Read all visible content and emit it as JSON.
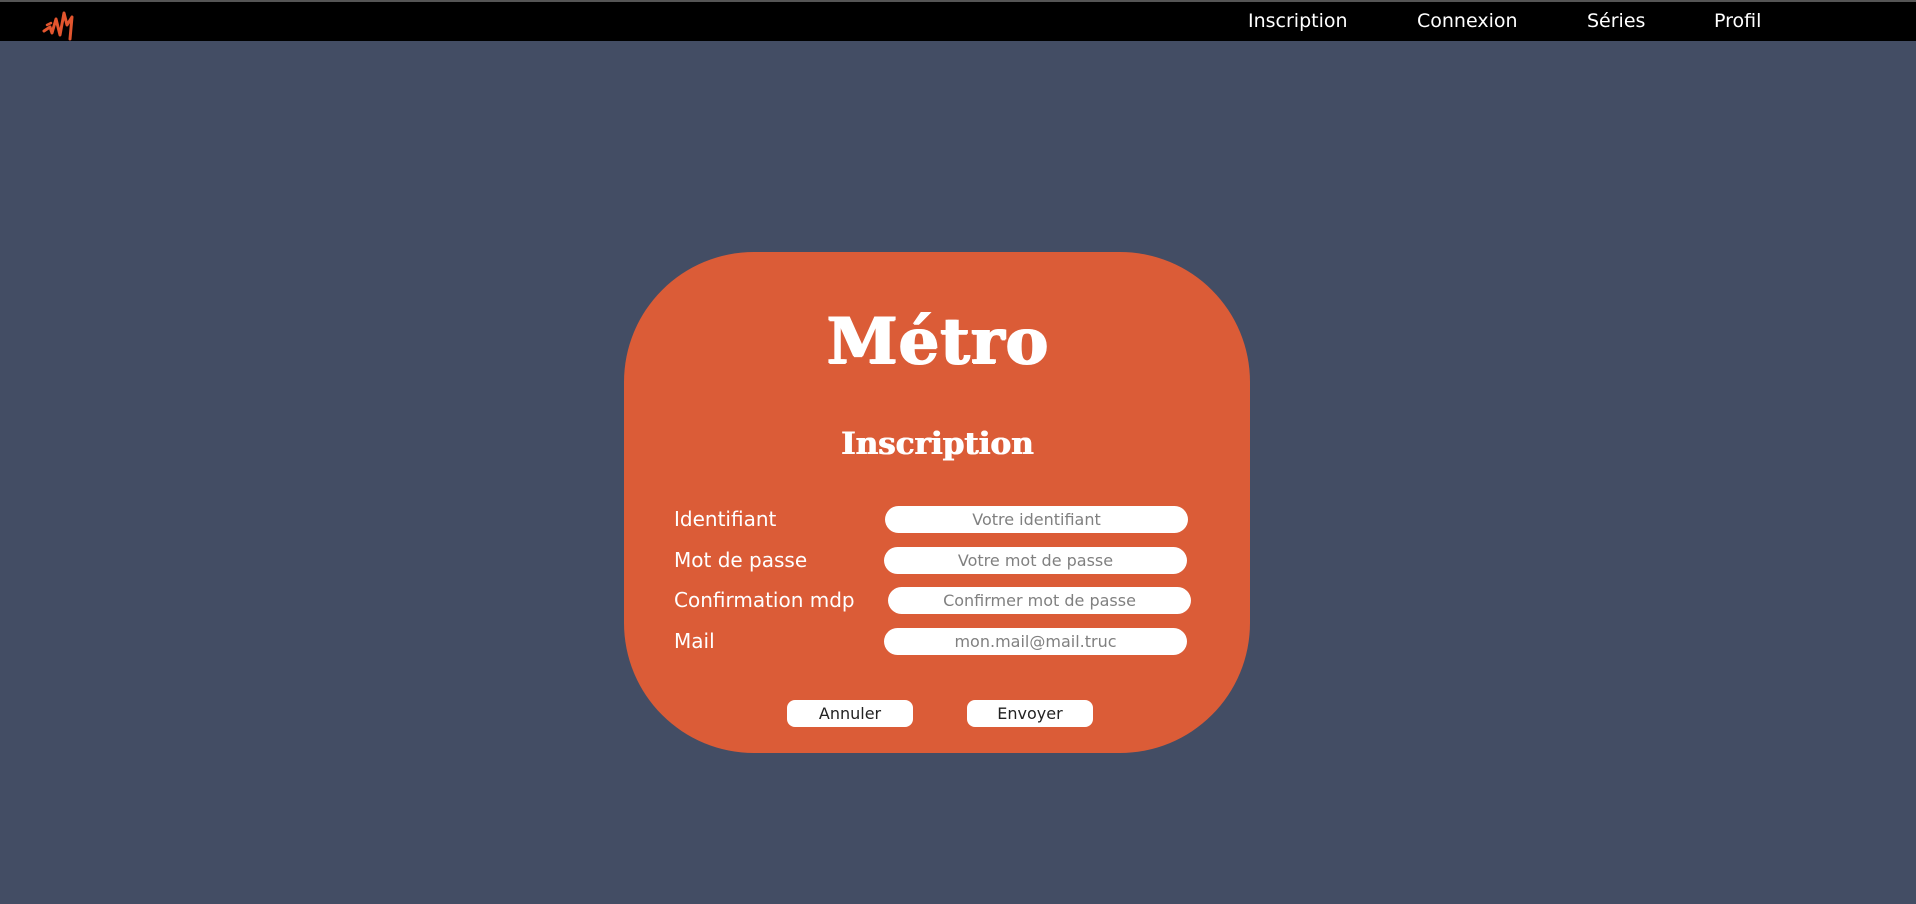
{
  "header": {
    "logo_icon": "logo-icon",
    "nav": [
      {
        "label": "Inscription"
      },
      {
        "label": "Connexion"
      },
      {
        "label": "Séries"
      },
      {
        "label": "Profil"
      }
    ]
  },
  "card": {
    "brand": "Métro",
    "title": "Inscription",
    "fields": [
      {
        "label": "Identifiant",
        "placeholder": "Votre identifiant",
        "value": ""
      },
      {
        "label": "Mot de passe",
        "placeholder": "Votre mot de passe",
        "value": ""
      },
      {
        "label": "Confirmation mdp",
        "placeholder": "Confirmer mot de passe",
        "value": ""
      },
      {
        "label": "Mail",
        "placeholder": "mon.mail@mail.truc",
        "value": ""
      }
    ],
    "buttons": {
      "cancel": "Annuler",
      "submit": "Envoyer"
    }
  },
  "colors": {
    "background": "#434d64",
    "topbar": "#000000",
    "card": "#db5c37",
    "logo_accent": "#e2552e",
    "text": "#ffffff"
  }
}
